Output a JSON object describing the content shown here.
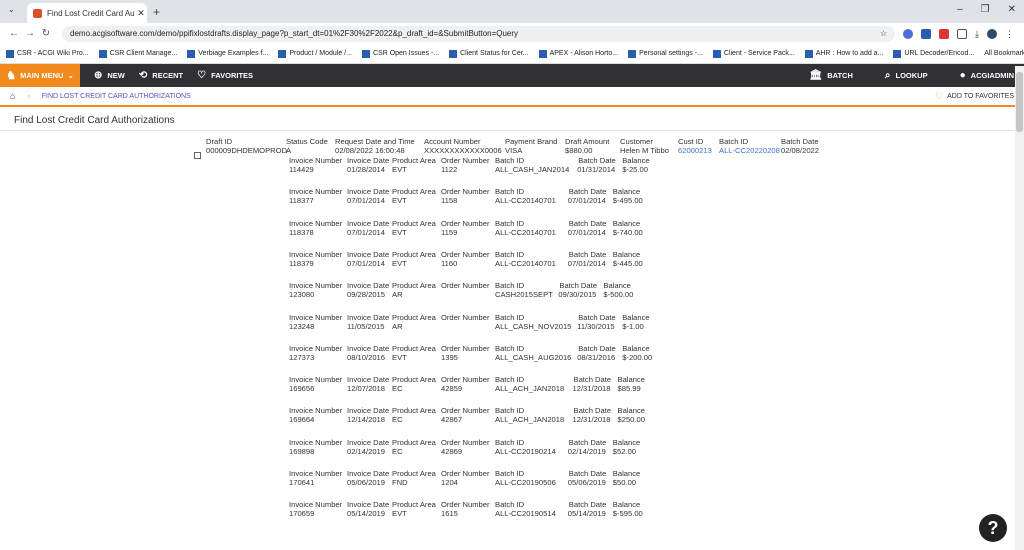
{
  "browser": {
    "tab_title": "Find Lost Credit Card Authoriza",
    "url": "demo.acgisoftware.com/demo/ppifixlostdrafts.display_page?p_start_dt=01%2F30%2F2022&p_draft_id=&SubmitButton=Query",
    "bookmarks": [
      "CSR - ACGI Wiki Pro...",
      "CSR Client Manage...",
      "Verbiage Examples f...",
      "Product / Module /...",
      "CSR Open Issues -...",
      "Client Status for Cer...",
      "APEX - Alison Horto...",
      "Personal settings -...",
      "Client - Service Pack...",
      "AHR : How to add a...",
      "URL Decoder/Encod..."
    ],
    "all_bookmarks": "All Bookmarks"
  },
  "appbar": {
    "main_menu": "MAIN MENU",
    "new": "NEW",
    "recent": "RECENT",
    "favorites": "FAVORITES",
    "batch": "BATCH",
    "lookup": "LOOKUP",
    "user": "ACGIADMIN"
  },
  "breadcrumb": {
    "current": "FIND LOST CREDIT CARD AUTHORIZATIONS",
    "add_favorites": "ADD TO FAVORITES"
  },
  "page_title": "Find Lost Credit Card Authorizations",
  "draft": {
    "headers": [
      "Draft ID",
      "Status Code",
      "Request Date and Time",
      "Account Number",
      "Payment Brand",
      "Draft Amount",
      "Customer",
      "Cust ID",
      "Batch ID",
      "Batch Date"
    ],
    "values": [
      "000009DHDEMOPROD",
      "A",
      "02/08/2022 16:00:48",
      "XXXXXXXXXXXX0006",
      "VISA",
      "$880.00",
      "Helen M Tibbo",
      "62000213",
      "ALL-CC20220208",
      "02/08/2022"
    ]
  },
  "invoice_headers": [
    "Invoice Number",
    "Invoice Date",
    "Product Area",
    "Order Number",
    "Batch ID",
    "Batch Date",
    "Balance"
  ],
  "invoices": [
    [
      "114429",
      "01/28/2014",
      "EVT",
      "1122",
      "ALL_CASH_JAN2014",
      "01/31/2014",
      "$-25.00"
    ],
    [
      "118377",
      "07/01/2014",
      "EVT",
      "1158",
      "ALL-CC20140701",
      "07/01/2014",
      "$-495.00"
    ],
    [
      "118378",
      "07/01/2014",
      "EVT",
      "1159",
      "ALL-CC20140701",
      "07/01/2014",
      "$-740.00"
    ],
    [
      "118379",
      "07/01/2014",
      "EVT",
      "1160",
      "ALL-CC20140701",
      "07/01/2014",
      "$-445.00"
    ],
    [
      "123080",
      "09/28/2015",
      "AR",
      "",
      "CASH2015SEPT",
      "09/30/2015",
      "$-500.00"
    ],
    [
      "123248",
      "11/05/2015",
      "AR",
      "",
      "ALL_CASH_NOV2015",
      "11/30/2015",
      "$-1.00"
    ],
    [
      "127373",
      "08/10/2016",
      "EVT",
      "1395",
      "ALL_CASH_AUG2016",
      "08/31/2016",
      "$-200.00"
    ],
    [
      "169656",
      "12/07/2018",
      "EC",
      "42859",
      "ALL_ACH_JAN2018",
      "12/31/2018",
      "$85.99"
    ],
    [
      "169664",
      "12/14/2018",
      "EC",
      "42867",
      "ALL_ACH_JAN2018",
      "12/31/2018",
      "$250.00"
    ],
    [
      "169898",
      "02/14/2019",
      "EC",
      "42869",
      "ALL-CC20190214",
      "02/14/2019",
      "$52.00"
    ],
    [
      "170641",
      "05/06/2019",
      "FND",
      "1204",
      "ALL-CC20190506",
      "05/06/2019",
      "$50.00"
    ],
    [
      "170659",
      "05/14/2019",
      "EVT",
      "1615",
      "ALL-CC20190514",
      "05/14/2019",
      "$-595.00"
    ]
  ]
}
